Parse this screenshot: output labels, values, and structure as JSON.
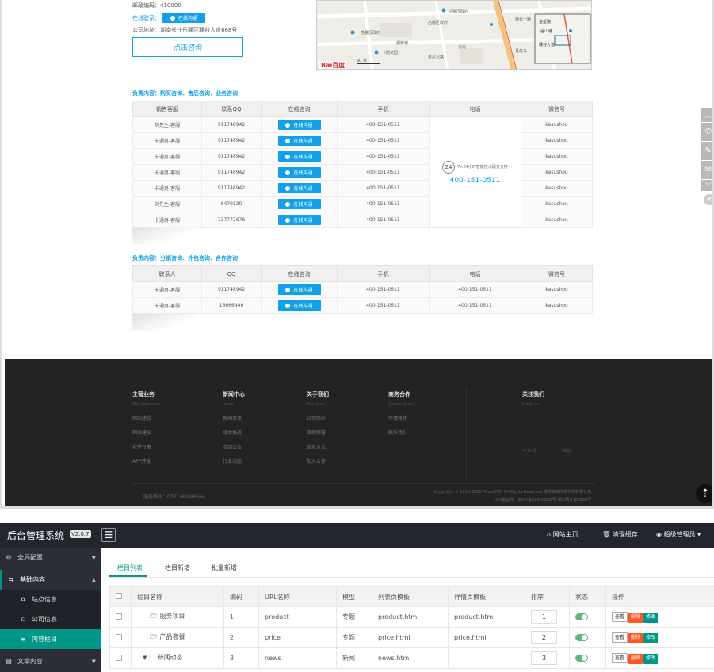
{
  "contact": {
    "postcode": "邮政编码：410000",
    "online_label": "在线联系：",
    "online_btn": "在线沟通",
    "address": "公司地址：湖南长沙岳麓区麓谷大道668号",
    "consult_btn": "点击咨询"
  },
  "map": {
    "logo": "Bai百度",
    "scale": "50 米",
    "labels": [
      "岳麓区政府",
      "卡酷花园",
      "岳麓区政府",
      "岳麓区政府",
      "桐梓坡",
      "金星北路",
      "方向",
      "西北一路",
      "月亮岛",
      "金星路",
      "谷山路",
      "麓谷大道"
    ]
  },
  "sales": {
    "title": "负责内容：购买咨询、售后咨询、业务咨询",
    "headers": [
      "销售客服",
      "联系QQ",
      "在线咨询",
      "手机",
      "电话",
      "微信号"
    ],
    "btn": "在线沟通",
    "rows": [
      {
        "name": "刘先生-客服",
        "qq": "911748942",
        "mobile": "400-151-0511",
        "wechat": "kasushou"
      },
      {
        "name": "卡通男-客服",
        "qq": "911748942",
        "mobile": "400-151-0511",
        "wechat": "kasushou"
      },
      {
        "name": "卡通男-客服",
        "qq": "911748942",
        "mobile": "400-151-0511",
        "wechat": "kasushou"
      },
      {
        "name": "卡通男-客服",
        "qq": "911748942",
        "mobile": "400-151-0511",
        "wechat": "kasushou"
      },
      {
        "name": "卡通男-客服",
        "qq": "911748942",
        "mobile": "400-151-0511",
        "wechat": "kasushou"
      },
      {
        "name": "刘先生-客服",
        "qq": "6479130",
        "mobile": "400-151-0511",
        "wechat": "kasushou"
      },
      {
        "name": "卡通男-客服",
        "qq": "737772676",
        "mobile": "400-151-0511",
        "wechat": "kasushou"
      }
    ],
    "phone_badge": "24",
    "phone_note": "7×24小时智能技术服务支持",
    "phone_number": "400-151-0511"
  },
  "partner": {
    "title": "负责内容：分销咨询、外包咨询、合作咨询",
    "headers": [
      "联系人",
      "QQ",
      "在线咨询",
      "手机",
      "电话",
      "微信号"
    ],
    "btn": "在线沟通",
    "rows": [
      {
        "name": "卡通男-客服",
        "qq": "911748942",
        "mobile": "400-151-0511",
        "phone": "400-151-0511",
        "wechat": "kasushou"
      },
      {
        "name": "卡通男-客服",
        "qq": "16666446",
        "mobile": "400-151-0511",
        "phone": "400-151-0511",
        "wechat": "kasushou"
      }
    ]
  },
  "footer": {
    "cols": [
      {
        "h": "主营业务",
        "s": "Main Business",
        "links": [
          "网站建设",
          "网站建设",
          "软件开发",
          "APP开发"
        ]
      },
      {
        "h": "新闻中心",
        "s": "News",
        "links": [
          "新闻资讯",
          "媒体报道",
          "活动公告",
          "行业动态"
        ]
      },
      {
        "h": "关于我们",
        "s": "About us",
        "links": [
          "公司简介",
          "资质荣誉",
          "联系方式",
          "加入合作"
        ]
      },
      {
        "h": "商务合作",
        "s": "Cooperation",
        "links": [
          "申请合作",
          "联系我们"
        ]
      },
      {
        "h": "关注我们",
        "s": "Focus on",
        "links": []
      }
    ],
    "follow": [
      "公众号",
      "微信"
    ],
    "hotline": "服务热线：0731-88886666",
    "copyright": "Copyright © 2018-2020 PbootCMS All Rights Reserved 湖南某某网络科技有限公司",
    "icp": "ICP备案号：湘ICP备88888888号   湘公网安备8888号"
  },
  "admin": {
    "brand": "后台管理系统",
    "version": "V2.0.7",
    "top_links": [
      "网站主页",
      "清理缓存",
      "超级管理员"
    ],
    "sidebar": [
      {
        "label": "全局配置"
      },
      {
        "label": "基础内容"
      },
      {
        "label": "站点信息"
      },
      {
        "label": "公司信息"
      },
      {
        "label": "内容栏目"
      },
      {
        "label": "文章内容"
      }
    ],
    "tabs": [
      "栏目列表",
      "栏目新增",
      "批量新增"
    ],
    "headers": [
      "",
      "栏目名称",
      "编码",
      "URL名称",
      "模型",
      "列表页模板",
      "详情页模板",
      "排序",
      "状态",
      "操作"
    ],
    "rows": [
      {
        "name": "服务项目",
        "code": "1",
        "url": "product",
        "model": "专题",
        "list_tpl": "product.html",
        "detail_tpl": "product.html",
        "sort": "1"
      },
      {
        "name": "产品套餐",
        "code": "2",
        "url": "price",
        "model": "专题",
        "list_tpl": "price.html",
        "detail_tpl": "price.html",
        "sort": "2"
      },
      {
        "name": "新闻动态",
        "code": "3",
        "url": "news",
        "model": "新闻",
        "list_tpl": "news.html",
        "detail_tpl": "",
        "sort": "3"
      }
    ],
    "ops": [
      "查看",
      "删除",
      "修改"
    ]
  },
  "colors": {
    "accent": "#12a0e8",
    "admin_accent": "#009688",
    "danger": "#ff5722",
    "dark": "#23262e"
  }
}
